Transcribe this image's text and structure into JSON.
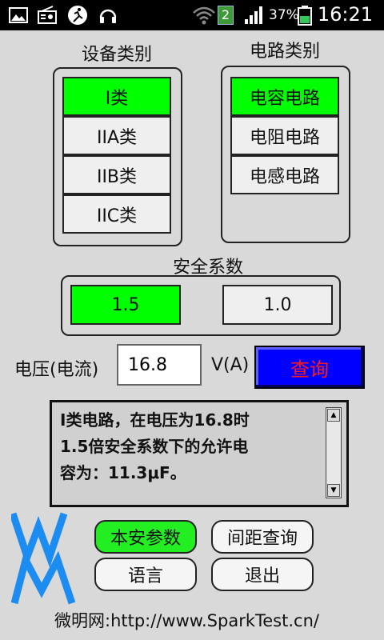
{
  "status": {
    "badge": "2",
    "battery": "37%",
    "time": "16:21",
    "icons": [
      "image-icon",
      "radio-icon",
      "running-icon",
      "headset-icon",
      "wifi-icon",
      "signal-icon",
      "battery-icon"
    ]
  },
  "device": {
    "title": "设备类别",
    "items": [
      "I类",
      "IIA类",
      "IIB类",
      "IIC类"
    ],
    "selected": 0
  },
  "circuit": {
    "title": "电路类别",
    "items": [
      "电容电路",
      "电阻电路",
      "电感电路"
    ],
    "selected": 0
  },
  "safety": {
    "title": "安全系数",
    "options": [
      "1.5",
      "1.0"
    ],
    "selected": 0
  },
  "voltage": {
    "label": "电压(电流)",
    "value": "16.8",
    "unit": "V(A)",
    "query_label": "查询"
  },
  "result": {
    "lines": [
      "I类电路，在电压为16.8时",
      "1.5倍安全系数下的允许电",
      "容为：11.3μF。"
    ]
  },
  "buttons": {
    "params": "本安参数",
    "spacing": "间距查询",
    "language": "语言",
    "exit": "退出"
  },
  "footer": "微明网:http://www.SparkTest.cn/",
  "colors": {
    "selected_green": "#00ff00",
    "query_blue": "#0000ff",
    "query_text": "#ff1a1a",
    "logo_blue": "#1c8cf0"
  }
}
